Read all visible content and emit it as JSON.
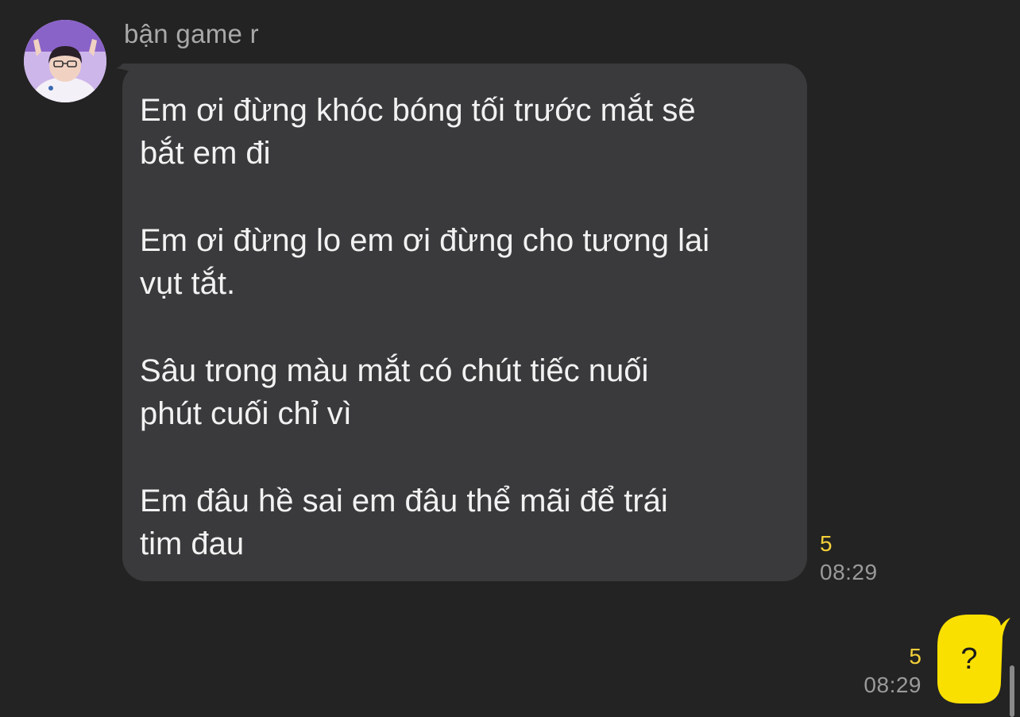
{
  "conversation": {
    "incoming": {
      "sender_name": "bận game r",
      "avatar_icon": "user-avatar-photo",
      "paragraphs": [
        "Em ơi đừng khóc bóng tối trước mắt sẽ\nbắt em đi",
        "Em ơi đừng lo em ơi đừng cho tương lai\nvụt tắt.",
        "Sâu trong màu mắt có chút tiếc nuối\nphút cuối chỉ vì",
        "Em đâu hề sai em đâu thể mãi để trái\ntim đau"
      ],
      "unread_count": "5",
      "time": "08:29",
      "bubble_color": "#3a3a3c"
    },
    "outgoing": {
      "text": "?",
      "unread_count": "5",
      "time": "08:29",
      "bubble_color": "#f9e000"
    }
  },
  "colors": {
    "background": "#232323",
    "unread": "#f4d038",
    "time": "#9a9a9a",
    "text": "#f2f2f2"
  }
}
